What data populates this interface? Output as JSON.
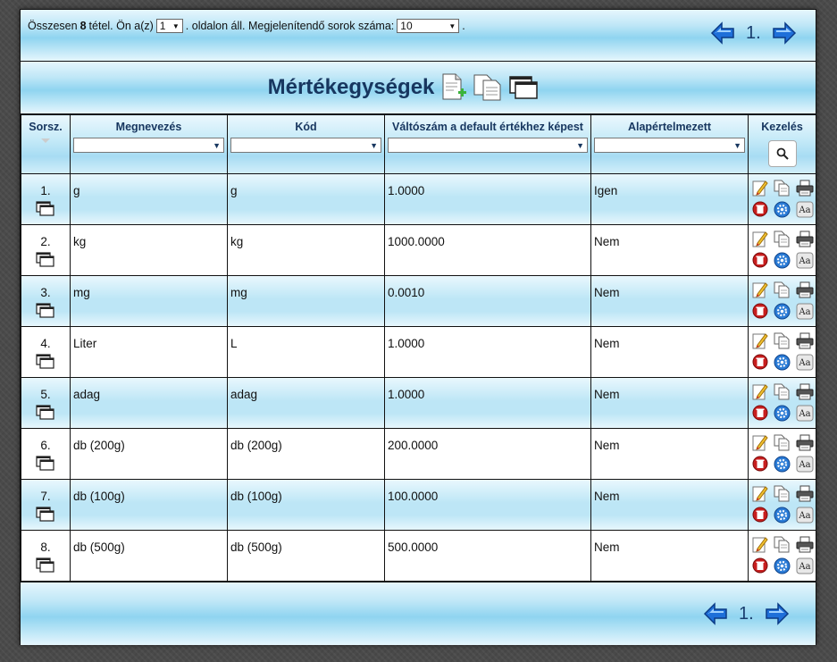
{
  "topbar": {
    "prefix": "Összesen",
    "total_count": "8",
    "mid": "tétel. Ön a(z)",
    "page_select": "1",
    "after_page": ". oldalon áll. Megjelenítendő sorok száma:",
    "rows_select": "10",
    "end": ".",
    "page_number": "1."
  },
  "title": "Mértékegységek",
  "columns": {
    "num": "Sorsz.",
    "name": "Megnevezés",
    "code": "Kód",
    "ratio": "Váltószám a default értékhez képest",
    "default": "Alapértelmezett",
    "actions": "Kezelés"
  },
  "rows": [
    {
      "num": "1.",
      "name": "g",
      "code": "g",
      "ratio": "1.0000",
      "default": "Igen"
    },
    {
      "num": "2.",
      "name": "kg",
      "code": "kg",
      "ratio": "1000.0000",
      "default": "Nem"
    },
    {
      "num": "3.",
      "name": "mg",
      "code": "mg",
      "ratio": "0.0010",
      "default": "Nem"
    },
    {
      "num": "4.",
      "name": "Liter",
      "code": "L",
      "ratio": "1.0000",
      "default": "Nem"
    },
    {
      "num": "5.",
      "name": "adag",
      "code": "adag",
      "ratio": "1.0000",
      "default": "Nem"
    },
    {
      "num": "6.",
      "name": "db (200g)",
      "code": "db (200g)",
      "ratio": "200.0000",
      "default": "Nem"
    },
    {
      "num": "7.",
      "name": "db (100g)",
      "code": "db (100g)",
      "ratio": "100.0000",
      "default": "Nem"
    },
    {
      "num": "8.",
      "name": "db (500g)",
      "code": "db (500g)",
      "ratio": "500.0000",
      "default": "Nem"
    }
  ],
  "footer": {
    "page_number": "1."
  },
  "icons": {
    "prev": "arrow-left-icon",
    "next": "arrow-right-icon",
    "new": "new-document-icon",
    "copy": "copy-icon",
    "windows": "windows-icon",
    "search": "search-icon",
    "edit": "edit-icon",
    "print": "print-icon",
    "delete": "delete-icon",
    "settings": "settings-icon",
    "translate": "translate-icon"
  },
  "colors": {
    "title": "#17365f",
    "sky": "#8fd4f0",
    "arrow": "#1e6fd9"
  }
}
